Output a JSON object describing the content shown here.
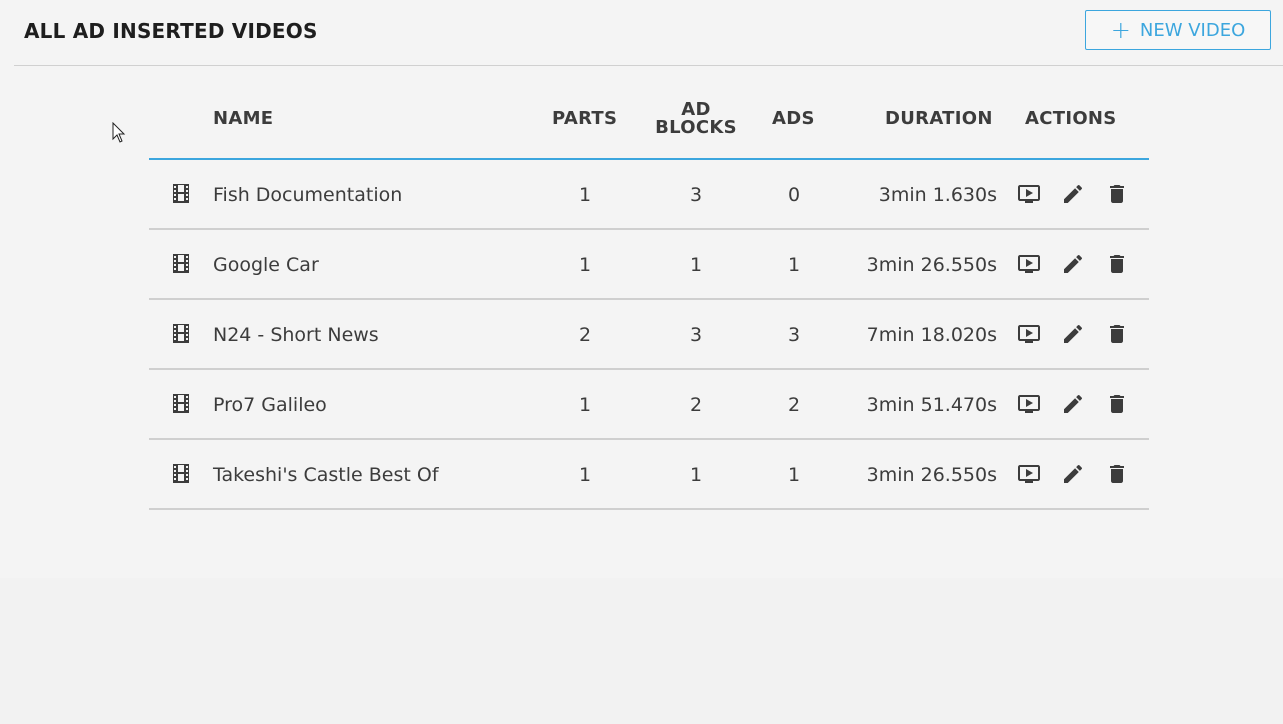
{
  "header": {
    "title": "ALL AD INSERTED VIDEOS",
    "new_button_label": "NEW VIDEO",
    "new_button_icon": "plus-icon"
  },
  "table": {
    "columns": {
      "name": "NAME",
      "parts": "PARTS",
      "ad_blocks_line1": "AD",
      "ad_blocks_line2": "BLOCKS",
      "ads": "ADS",
      "duration": "DURATION",
      "actions": "ACTIONS"
    },
    "rows": [
      {
        "name": "Fish Documentation",
        "parts": "1",
        "ad_blocks": "3",
        "ads": "0",
        "duration": "3min 1.630s"
      },
      {
        "name": "Google Car",
        "parts": "1",
        "ad_blocks": "1",
        "ads": "1",
        "duration": "3min 26.550s"
      },
      {
        "name": "N24 - Short News",
        "parts": "2",
        "ad_blocks": "3",
        "ads": "3",
        "duration": "7min 18.020s"
      },
      {
        "name": "Pro7 Galileo",
        "parts": "1",
        "ad_blocks": "2",
        "ads": "2",
        "duration": "3min 51.470s"
      },
      {
        "name": "Takeshi's Castle Best Of",
        "parts": "1",
        "ad_blocks": "1",
        "ads": "1",
        "duration": "3min 26.550s"
      }
    ],
    "row_icon": "film-icon",
    "action_icons": [
      "play-video-icon",
      "edit-pencil-icon",
      "delete-trash-icon"
    ]
  },
  "colors": {
    "accent": "#3ca6de",
    "text": "#3c3c3c",
    "title": "#1e1e1e"
  }
}
